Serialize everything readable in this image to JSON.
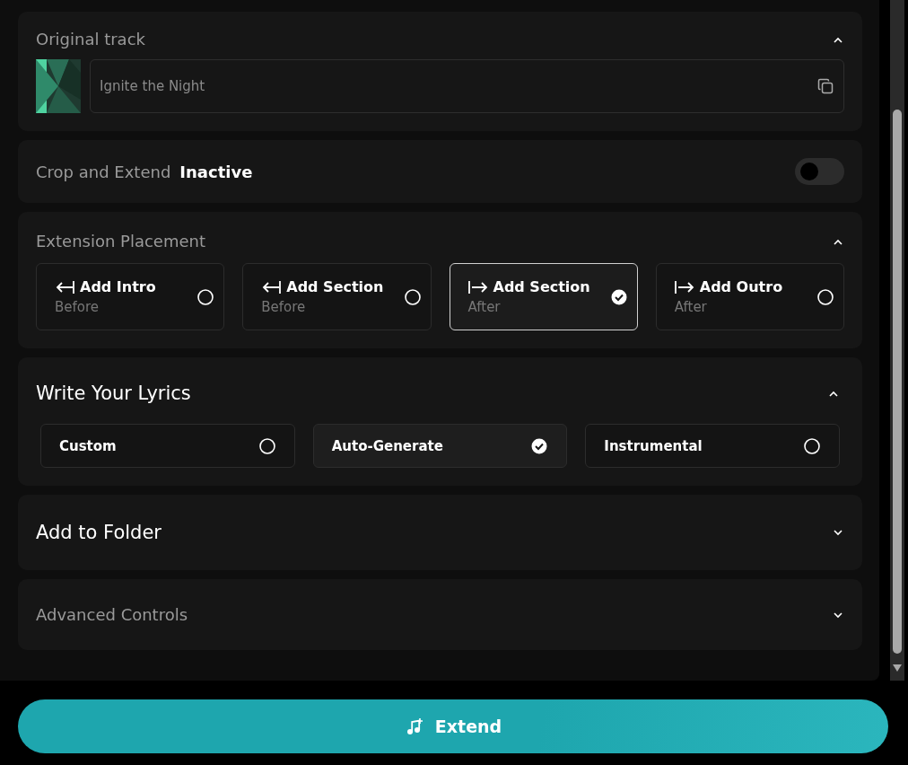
{
  "sections": [
    {
      "kind": "track",
      "title": "Original track",
      "expanded": true,
      "track_name": "Ignite the Night"
    },
    {
      "kind": "toggle",
      "title": "Crop and Extend",
      "status": "Inactive",
      "on": false
    },
    {
      "kind": "placement",
      "title": "Extension Placement",
      "expanded": true,
      "options": [
        {
          "kind": "before",
          "label": "Add Intro",
          "sub": "Before",
          "selected": false
        },
        {
          "kind": "before",
          "label": "Add Section",
          "sub": "Before",
          "selected": false
        },
        {
          "kind": "after",
          "label": "Add Section",
          "sub": "After",
          "selected": true
        },
        {
          "kind": "after",
          "label": "Add Outro",
          "sub": "After",
          "selected": false
        }
      ]
    },
    {
      "kind": "lyrics",
      "title": "Write Your Lyrics",
      "expanded": true,
      "options": [
        {
          "label": "Custom",
          "selected": false
        },
        {
          "label": "Auto-Generate",
          "selected": true
        },
        {
          "label": "Instrumental",
          "selected": false
        }
      ]
    },
    {
      "kind": "heading",
      "title": "Add to Folder",
      "expanded": false
    },
    {
      "kind": "plain",
      "title": "Advanced Controls",
      "expanded": false
    }
  ],
  "action": {
    "label": "Extend"
  }
}
